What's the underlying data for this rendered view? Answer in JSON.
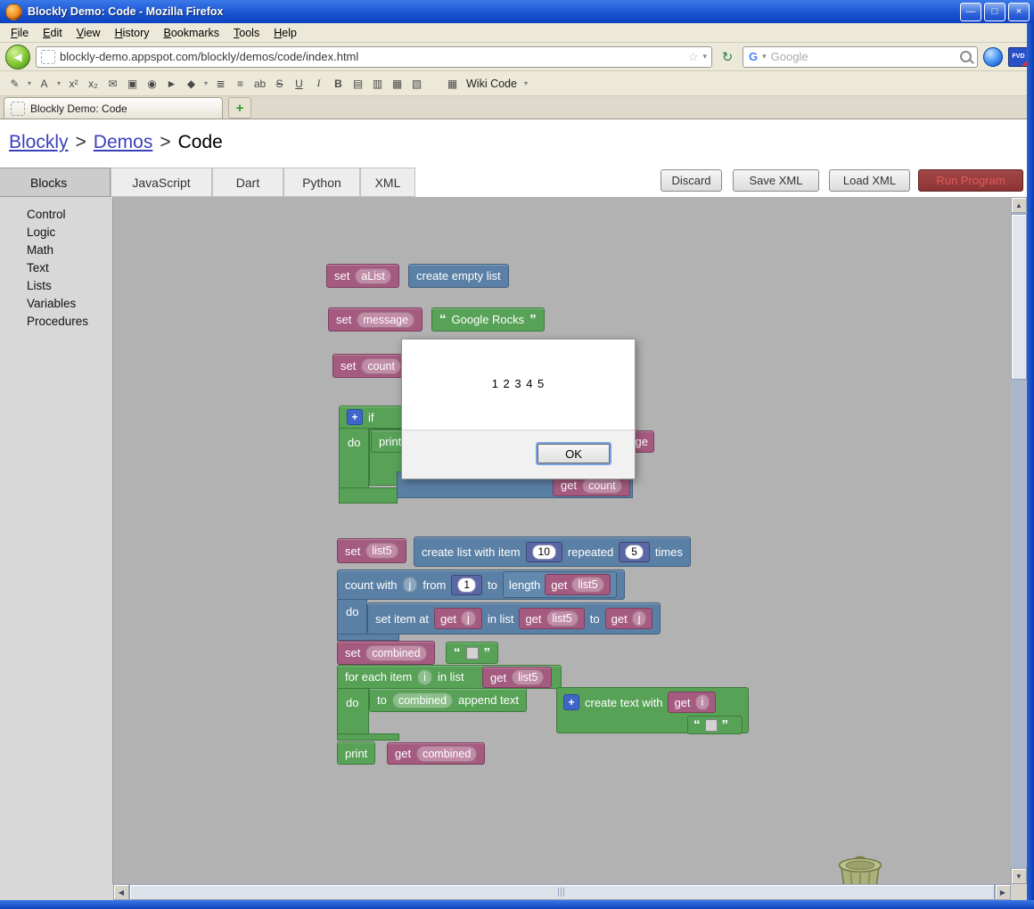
{
  "window": {
    "title": "Blockly Demo: Code - Mozilla Firefox",
    "minimize": "—",
    "maximize": "□",
    "close": "×"
  },
  "menubar": {
    "items": [
      "File",
      "Edit",
      "View",
      "History",
      "Bookmarks",
      "Tools",
      "Help"
    ]
  },
  "navbar": {
    "back": "◀",
    "url": "blockly-demo.appspot.com/blockly/demos/code/index.html",
    "star": "☆",
    "caret": "▾",
    "reload": "↻",
    "google_g": "G",
    "search_placeholder": "Google"
  },
  "format_toolbar": {
    "glyphs": {
      "pencil": "✎",
      "caret": "▾",
      "font": "A",
      "sup": "x²",
      "sub": "x₂",
      "mail": "✉",
      "image": "▣",
      "smiley": "◉",
      "go": "►",
      "paint": "◆",
      "num_list": "≣",
      "bullet_list": "≡",
      "footnote": "ab",
      "strike": "S",
      "underline": "U",
      "italic": "I",
      "bold": "B",
      "align_left": "▤",
      "align_center": "▥",
      "align_right": "▦",
      "align_justify": "▧",
      "wiki_icon": "▦"
    },
    "wiki_label": "Wiki Code"
  },
  "tabbar": {
    "title": "Blockly Demo: Code",
    "new_tab": "+"
  },
  "breadcrumb": {
    "link1": "Blockly",
    "sep": ">",
    "link2": "Demos",
    "current": "Code"
  },
  "panel": {
    "blocks_tab": "Blocks",
    "categories": [
      "Control",
      "Logic",
      "Math",
      "Text",
      "Lists",
      "Variables",
      "Procedures"
    ],
    "tabs": [
      "JavaScript",
      "Dart",
      "Python",
      "XML"
    ],
    "buttons": {
      "discard": "Discard",
      "save": "Save XML",
      "load": "Load XML",
      "run": "Run Program"
    }
  },
  "dialog": {
    "message": "1 2 3 4 5",
    "ok": "OK"
  },
  "ws": {
    "set": "set",
    "get": "get",
    "do": "do",
    "if": "if",
    "print": "print",
    "to": "to",
    "mutator": "+",
    "vars": {
      "aList": "aList",
      "message": "message",
      "count": "count",
      "list5": "list5",
      "combined": "combined",
      "j": "j",
      "i": "i"
    },
    "create_empty_list": "create empty list",
    "q_open": "“",
    "q_close": "”",
    "google_rocks": "Google Rocks",
    "partial_get": "ge",
    "create_list": {
      "a": "create list with item",
      "n1": "10",
      "b": "repeated",
      "n2": "5",
      "c": "times"
    },
    "count_loop": {
      "a": "count with",
      "b": "from",
      "n": "1",
      "c": "to",
      "length": "length"
    },
    "set_item": {
      "a": "set item at",
      "b": "in list",
      "c": "to"
    },
    "for_each": {
      "a": "for each item",
      "b": "in list"
    },
    "append": {
      "b": "append text"
    },
    "create_text": "create text with"
  }
}
